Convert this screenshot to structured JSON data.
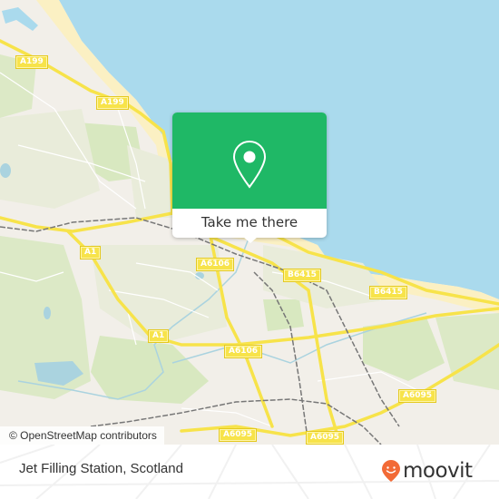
{
  "map": {
    "colors": {
      "sea": "#aadaed",
      "land": "#f2efe9",
      "beach": "#fbf0c3",
      "park": "#d8e8c0",
      "residential": "#e8ecd8",
      "road_major": "#f7e34a",
      "railway": "#777777",
      "water_inland": "#aad3df"
    },
    "road_labels": [
      {
        "id": "a199-1",
        "text": "A199"
      },
      {
        "id": "a199-2",
        "text": "A199"
      },
      {
        "id": "a1-1",
        "text": "A1"
      },
      {
        "id": "a6106-1",
        "text": "A6106"
      },
      {
        "id": "b6415-1",
        "text": "B6415"
      },
      {
        "id": "b6415-2",
        "text": "B6415"
      },
      {
        "id": "a1-2",
        "text": "A1"
      },
      {
        "id": "a6106-2",
        "text": "A6106"
      },
      {
        "id": "a6095-1",
        "text": "A6095"
      },
      {
        "id": "a6095-2",
        "text": "A6095"
      },
      {
        "id": "a6095-3",
        "text": "A6095"
      }
    ],
    "attribution": "© OpenStreetMap contributors"
  },
  "popup": {
    "button_label": "Take me there",
    "accent": "#1fb866",
    "icon": "map-pin-icon"
  },
  "footer": {
    "place_name": "Jet Filling Station, Scotland",
    "brand": "moovit",
    "brand_color": "#f26a36"
  }
}
